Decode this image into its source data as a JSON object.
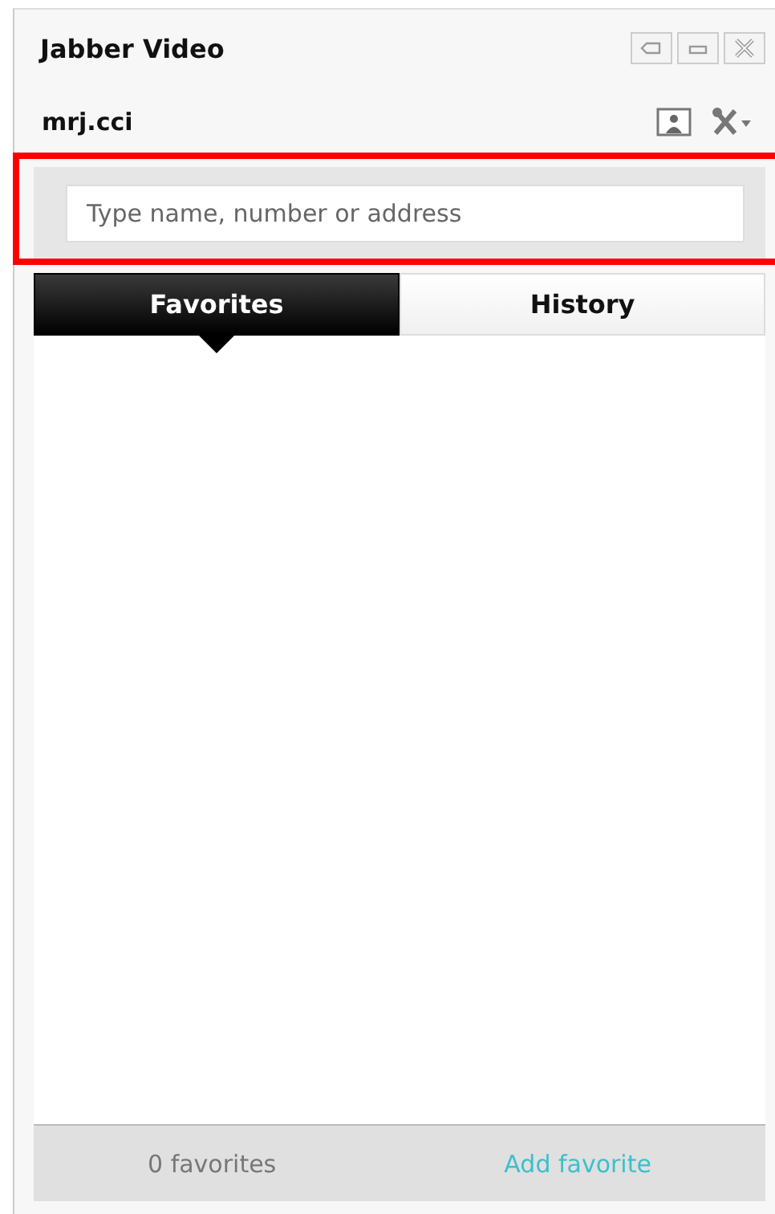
{
  "window": {
    "title": "Jabber Video"
  },
  "user": {
    "name": "mrj.cci"
  },
  "search": {
    "placeholder": "Type name, number or address"
  },
  "tabs": [
    {
      "label": "Favorites",
      "selected": true
    },
    {
      "label": "History",
      "selected": false
    }
  ],
  "footer": {
    "count": "0 favorites",
    "link": "Add favorite"
  }
}
